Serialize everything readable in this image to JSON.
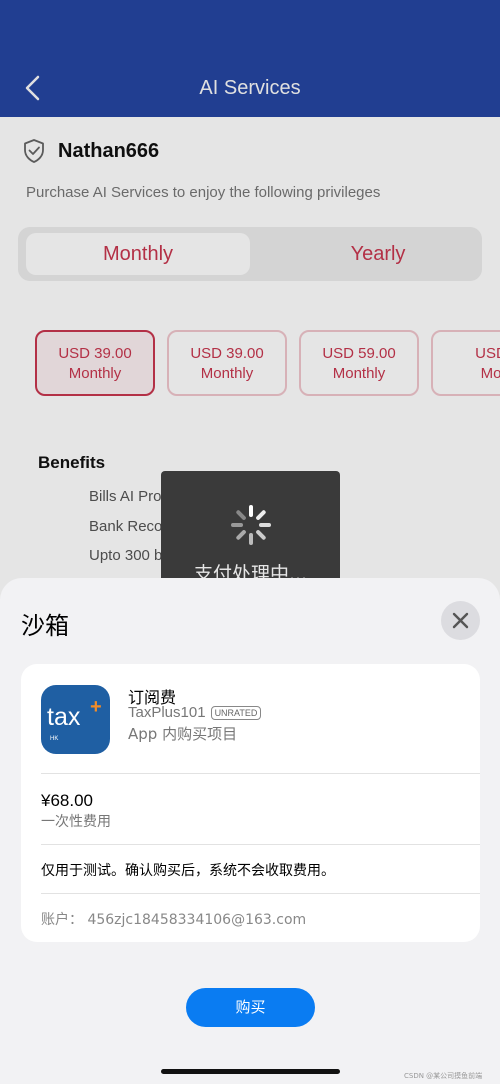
{
  "navbar": {
    "title": "AI Services",
    "back_icon": "chevron-left-icon",
    "bg_color": "#2647a6"
  },
  "profile": {
    "username": "Nathan666",
    "badge_icon": "shield-check-icon",
    "subtitle": "Purchase AI Services to enjoy the following privileges"
  },
  "tabs": [
    {
      "label": "Monthly",
      "active": true
    },
    {
      "label": "Yearly",
      "active": false
    }
  ],
  "plans": [
    {
      "price": "USD 39.00",
      "period": "Monthly",
      "selected": true
    },
    {
      "price": "USD 39.00",
      "period": "Monthly",
      "selected": false
    },
    {
      "price": "USD 59.00",
      "period": "Monthly",
      "selected": false
    },
    {
      "price": "USD",
      "period": "Mo",
      "selected": false
    }
  ],
  "benefits": {
    "title": "Benefits",
    "items": [
      "Bills AI Processing",
      "Bank Reconciliation",
      "Upto 300 bills monthly"
    ]
  },
  "loading": {
    "text": "支付处理中..."
  },
  "sheet": {
    "title": "沙箱",
    "close_icon": "close-icon",
    "product": {
      "name": "订阅费",
      "app_name": "TaxPlus101",
      "rating": "UNRATED",
      "type": "App 内购买项目",
      "icon_text": "tax",
      "icon_plus": "+",
      "icon_region": "HK"
    },
    "price": "¥68.00",
    "price_type": "一次性费用",
    "notice": "仅用于测试。确认购买后，系统不会收取费用。",
    "account": "账户：   456zjc18458334106@163.com",
    "buy_label": "购买"
  },
  "watermark": "CSDN @某公司摸鱼前端",
  "colors": {
    "accent": "#c8364e",
    "buy_button": "#0a7cf2"
  }
}
